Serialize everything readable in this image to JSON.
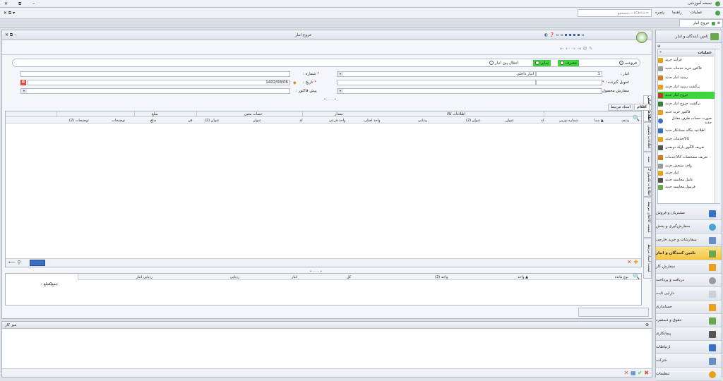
{
  "app": {
    "title": "نسخه آموزشی",
    "search_placeholder": "جستجو... (Ctrl+="
  },
  "menubar": {
    "items": [
      "عملیات",
      "راهنما",
      "پنجره"
    ]
  },
  "doc_tab": {
    "label": "خروج انبار"
  },
  "window": {
    "title": "خروج انبار"
  },
  "form": {
    "radios": [
      "فروشی",
      "مصرف",
      "سایر",
      "انتقال بین انبار"
    ],
    "store_label": "انبار :",
    "store_value": "1",
    "store_name": "انبار داخلی",
    "number_label": "شماره :",
    "receiver_label": "تحویل گیرنده :",
    "date_label": "تاریخ :",
    "date_value": "1402/08/06",
    "order_label": "سفارش محصول:",
    "invoice_label": "پیش فاکتور :"
  },
  "side_tabs": [
    "اطلاعات اصلی",
    "اطلاعات تکمیلی",
    "سند",
    "اطلاعات تکمیلی 2",
    "لیست کالاهای مرتبط",
    "لیست اسناد مرتبط"
  ],
  "grid_tabs": [
    "اقلام",
    "اسناد مرتبط"
  ],
  "grid": {
    "groups": [
      "اطلاعات کالا",
      "مقدار",
      "حساب معین",
      "مبلغ"
    ],
    "columns": [
      "ردیف",
      "مبنا",
      "شماره توزین",
      "کد",
      "عنوان",
      "عنوان (2)",
      "ردیابی",
      "واحد اصلی",
      "واحد فرعی",
      "کد",
      "عنوان",
      "عنوان (2)",
      "فی",
      "مبلغ",
      "توضیحات",
      "توضیحات (2)"
    ]
  },
  "summary": {
    "columns": [
      "نوع مانده",
      "واحد",
      "واحد (2)",
      "کل",
      "انبار",
      "ردیابی",
      "ردیابی انبار"
    ],
    "total_label": "جمع مبلغ :",
    "total_value": "0"
  },
  "workspace": {
    "title": "میز کار"
  },
  "right_panel": {
    "header": "تامین کنندگان و انبار",
    "ops_title": "عملیات",
    "ops": [
      "فرآیند خرید",
      "فاکتور خرید خدمات جدید",
      "رسید انبار جدید",
      "برگشت رسید انبار جدید",
      "خروج انبار جدید",
      "برگشت خروج انبار جدید",
      "فاکتور خرید جدید",
      "صورت حساب طرف مقابل جدید",
      "اطلاعیه بنگاه بستانکار جدید",
      "کالا/خدمات جدید",
      "تعریف الگوی بارکد دوبعدی",
      "تعریف مشخصات کالا/خدمات",
      "واحد سنجش جدید",
      "انبار جدید",
      "عامل محاسبه جدید",
      "فرمول محاسبه جدید"
    ],
    "nav": [
      "مشتریان و فروش",
      "سفارش‌گیری و پخش",
      "سفارشات و خرید خارجی",
      "تامین کنندگان و انبار",
      "سفارش کار",
      "دریافت و پرداخت",
      "دارایی ثابت",
      "حسابداری",
      "حقوق و دستمزد",
      "پیمانکاری",
      "ارتباطات",
      "شرکت",
      "تنظیمات"
    ]
  },
  "colors": {
    "accent": "#f5c542",
    "green": "#3ed63e"
  }
}
